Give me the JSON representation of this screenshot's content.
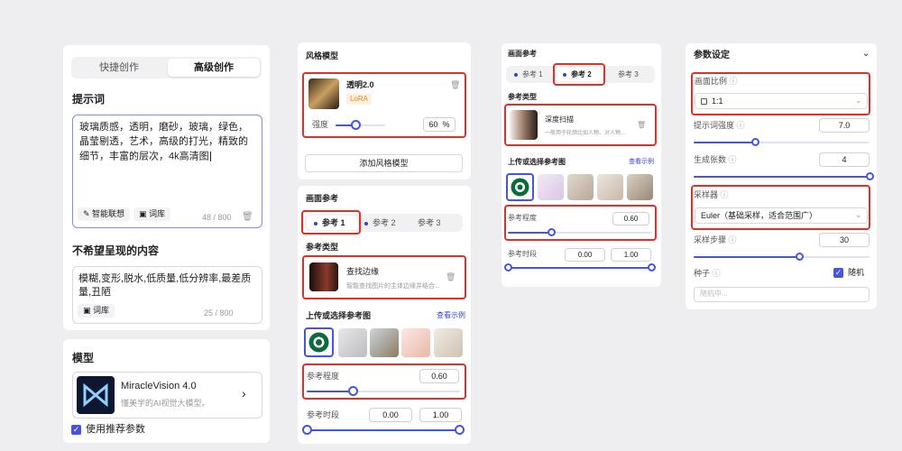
{
  "p1": {
    "tab_quick": "快捷创作",
    "tab_advanced": "高级创作",
    "prompt_label": "提示词",
    "prompt_lines": [
      "玻璃质感，透明，磨砂，玻璃，绿色，",
      "晶莹剔透，艺术，高级的打光，精致的",
      "细节，丰富的层次，4k高清图"
    ],
    "smart_btn": "智能联想",
    "lexicon_btn": "词库",
    "prompt_count": "48 / 800",
    "neg_label": "不希望呈现的内容",
    "neg_lines": [
      "模糊,变形,脱水,低质量,低分辨率,最差质",
      "量,丑陋"
    ],
    "neg_lexicon": "词库",
    "neg_count": "25 / 800",
    "model_label": "模型",
    "model_name": "MiracleVision 4.0",
    "model_desc": "懂美学的AI视觉大模型。",
    "use_recommended": "使用推荐参数"
  },
  "p2": {
    "style_title": "风格模型",
    "style_name": "透明2.0",
    "lora": "LoRA",
    "strength_label": "强度",
    "strength_value": "60",
    "strength_unit": "%",
    "strength": 0.4,
    "add_style": "添加风格模型",
    "ref_title": "画面参考",
    "ref_tabs": [
      "参考 1",
      "参考 2",
      "参考 3"
    ],
    "ref_type_label": "参考类型",
    "ref_type_name": "查找边缘",
    "ref_type_desc": "智能查找图片的主体边缘并结合...",
    "upload_label": "上传或选择参考图",
    "view_example": "查看示例",
    "degree_label": "参考程度",
    "degree_value": "0.60",
    "degree": 0.3,
    "period_label": "参考时段",
    "period_start": "0.00",
    "period_end": "1.00"
  },
  "p3": {
    "ref_title": "画面参考",
    "ref_tabs": [
      "参考 1",
      "参考 2",
      "参考 3"
    ],
    "ref_type_label": "参考类型",
    "ref_type_name": "深度扫描",
    "ref_type_desc": "一般用于轮廓比如人物、对人物...",
    "upload_label": "上传或选择参考图",
    "view_example": "查看示例",
    "degree_label": "参考程度",
    "degree_value": "0.60",
    "degree": 0.3,
    "period_label": "参考时段",
    "period_start": "0.00",
    "period_end": "1.00"
  },
  "p4": {
    "title": "参数设定",
    "ratio_label": "画面比例",
    "ratio_value": "1:1",
    "prompt_strength_label": "提示词强度",
    "prompt_strength_value": "7.0",
    "prompt_strength": 0.35,
    "count_label": "生成张数",
    "count_value": "4",
    "count": 1.0,
    "sampler_label": "采样器",
    "sampler_value": "Euler（基础采样，适合范围广）",
    "steps_label": "采样步骤",
    "steps_value": "30",
    "steps": 0.6,
    "seed_label": "种子",
    "random_label": "随机",
    "seed_placeholder": "随机中..."
  },
  "colors": {
    "accent": "#4455e0",
    "highlight": "#e0302a",
    "link": "#3344cc"
  }
}
